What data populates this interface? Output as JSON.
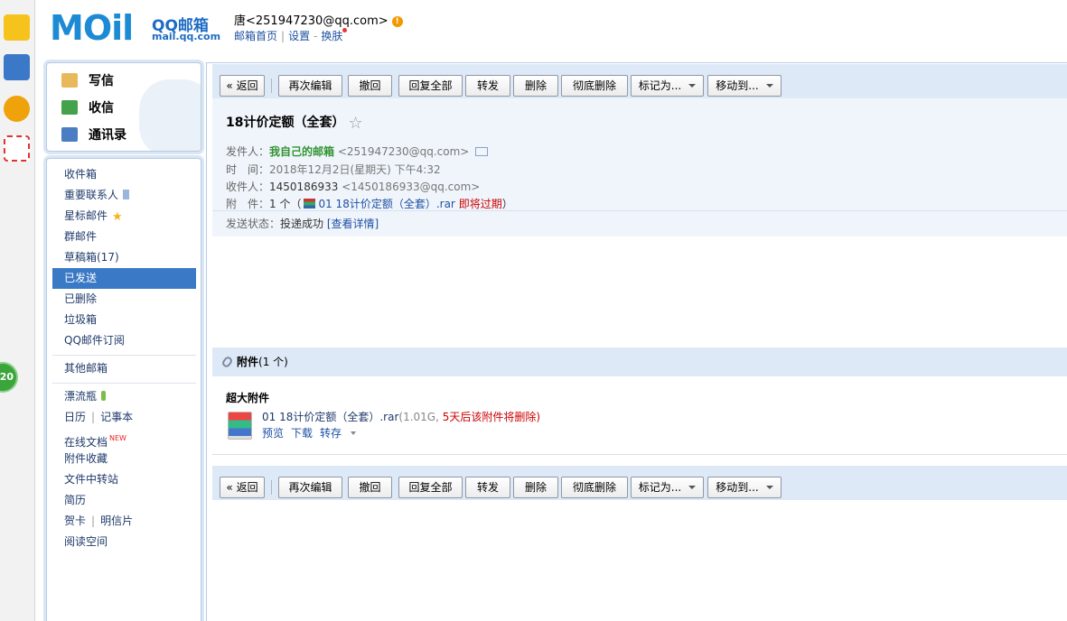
{
  "header": {
    "logo_text": "MOil",
    "logo_sub": "QQ邮箱",
    "logo_url": "mail.qq.com",
    "account": "唐<251947230@qq.com>",
    "nav": [
      "邮箱首页",
      "设置",
      "换肤"
    ]
  },
  "rail": {
    "badge": "20"
  },
  "quick": {
    "write": "写信",
    "receive": "收信",
    "contacts": "通讯录"
  },
  "folders": [
    "收件箱",
    "重要联系人",
    "星标邮件",
    "群邮件",
    "草稿箱(17)",
    "已发送",
    "已删除",
    "垃圾箱",
    "QQ邮件订阅"
  ],
  "other_mailbox": "其他邮箱",
  "tools": {
    "bottle": "漂流瓶",
    "calendar": "日历",
    "notes": "记事本",
    "docs": "在线文档",
    "new_tag": "NEW",
    "attachments": "附件收藏",
    "transfer": "文件中转站",
    "resume": "简历",
    "card": "贺卡",
    "postcard": "明信片",
    "reading": "阅读空间"
  },
  "toolbar": {
    "back": "« 返回",
    "reedit": "再次编辑",
    "recall": "撤回",
    "reply_all": "回复全部",
    "forward": "转发",
    "delete": "删除",
    "delete_perm": "彻底删除",
    "mark_as": "标记为...",
    "move_to": "移动到..."
  },
  "mail": {
    "subject": "18计价定额（全套）",
    "star": "☆",
    "from_label": "发件人：",
    "from_name": "我自己的邮箱",
    "from_addr": "<251947230@qq.com>",
    "time_label": "时　间：",
    "time": "2018年12月2日(星期天) 下午4:32",
    "to_label": "收件人：",
    "to_name": "1450186933",
    "to_addr": "<1450186933@qq.com>",
    "att_label": "附　件：",
    "att_count": "1 个（",
    "att_name": "01 18计价定额（全套）.rar",
    "att_expire": "即将过期",
    "att_close": "）",
    "status_label": "发送状态：",
    "status": "投递成功",
    "status_link": "[查看详情]"
  },
  "attachments": {
    "header": "附件",
    "count": "(1 个)",
    "section": "超大附件",
    "file_name": "01 18计价定额（全套）.rar",
    "file_size": "(1.01G,",
    "file_note": "5天后该附件将删除",
    "file_close": ")",
    "preview": "预览",
    "download": "下载",
    "save": "转存"
  }
}
